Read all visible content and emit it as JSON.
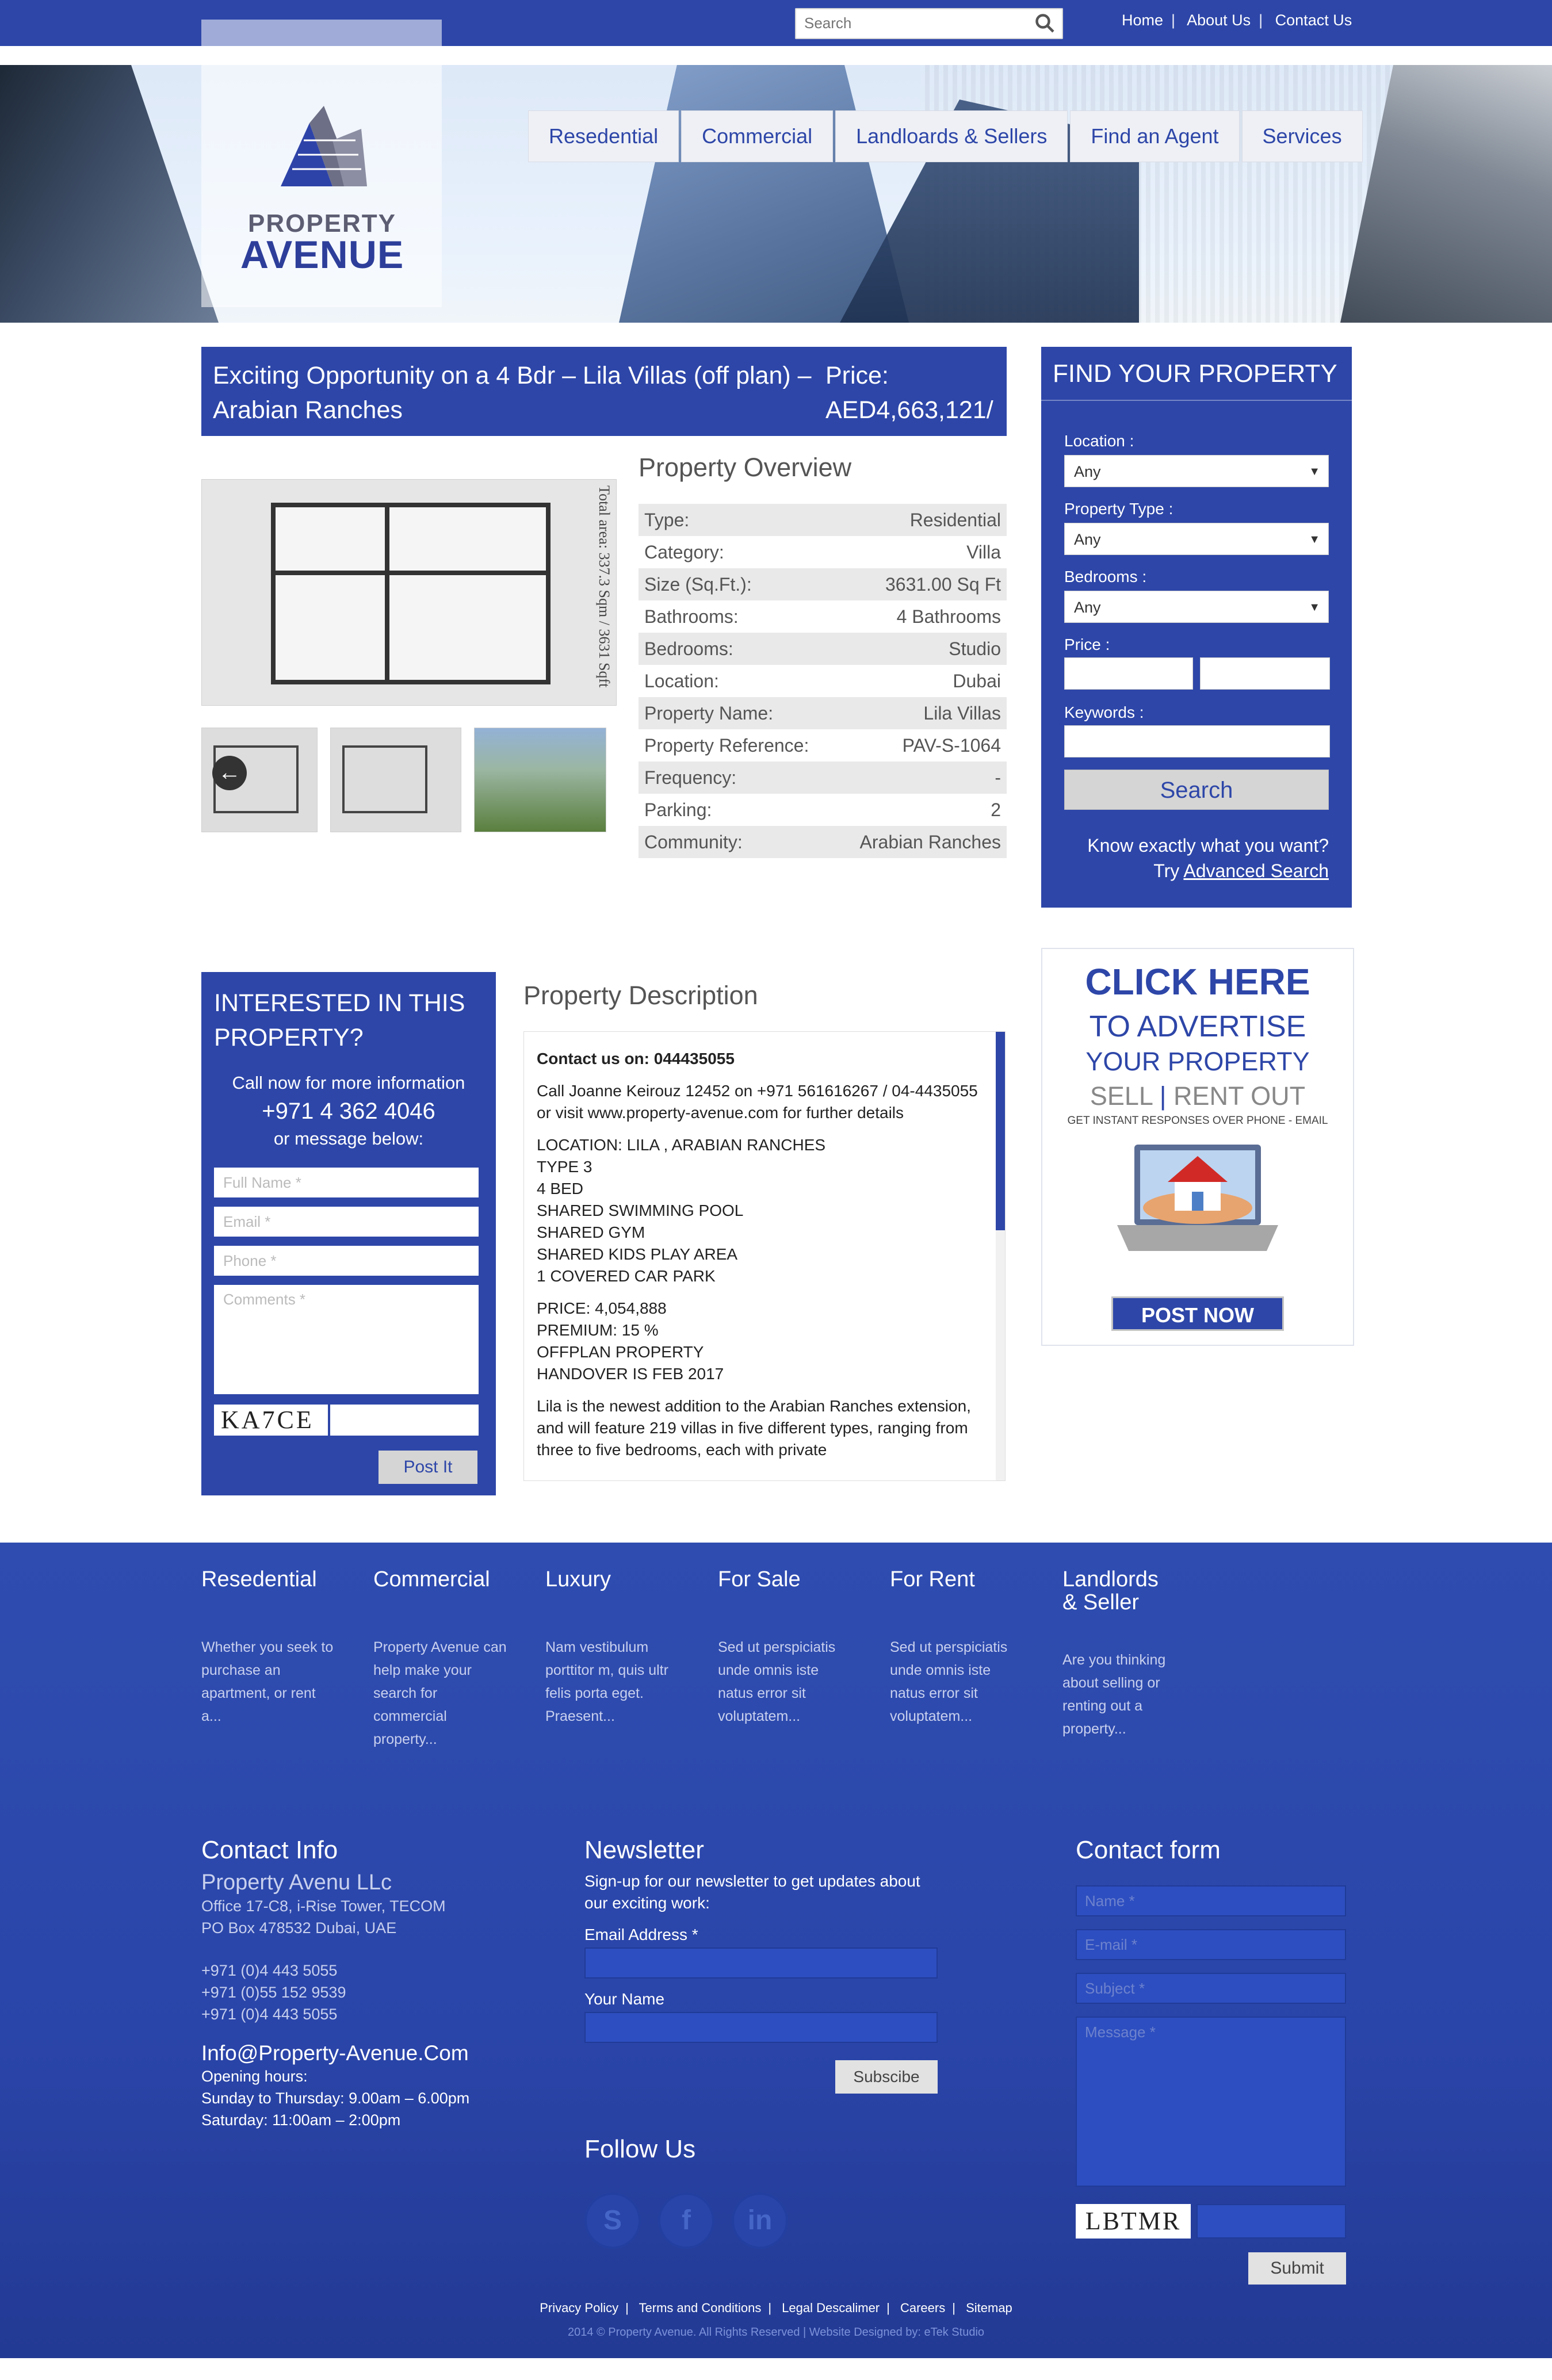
{
  "header": {
    "search_placeholder": "Search",
    "top_links": [
      "Home",
      "About Us",
      "Contact Us"
    ],
    "logo_line1": "PROPERTY",
    "logo_line2": "AVENUE",
    "nav": [
      "Resedential",
      "Commercial",
      "Landloards & Sellers",
      "Find an Agent",
      "Services"
    ]
  },
  "listing": {
    "title": "Exciting Opportunity on a 4 Bdr – Lila Villas (off plan) – Arabian Ranches",
    "price_label": "Price:",
    "price_value": "AED4,663,121/",
    "floorplan_text": "Total area: 337.3 Sqm / 3631 Sqft",
    "overview_title": "Property Overview",
    "overview": [
      {
        "label": "Type:",
        "value": "Residential"
      },
      {
        "label": "Category:",
        "value": "Villa"
      },
      {
        "label": "Size (Sq.Ft.):",
        "value": "3631.00 Sq Ft"
      },
      {
        "label": "Bathrooms:",
        "value": "4 Bathrooms"
      },
      {
        "label": "Bedrooms:",
        "value": "Studio"
      },
      {
        "label": "Location:",
        "value": "Dubai"
      },
      {
        "label": "Property Name:",
        "value": "Lila Villas"
      },
      {
        "label": "Property Reference:",
        "value": "PAV-S-1064"
      },
      {
        "label": "Frequency:",
        "value": "-"
      },
      {
        "label": "Parking:",
        "value": "2"
      },
      {
        "label": "Community:",
        "value": "Arabian Ranches"
      }
    ]
  },
  "find": {
    "title": "FIND YOUR PROPERTY",
    "location_label": "Location :",
    "location_value": "Any",
    "type_label": "Property Type :",
    "type_value": "Any",
    "bedrooms_label": "Bedrooms :",
    "bedrooms_value": "Any",
    "price_label": "Price :",
    "keywords_label": "Keywords :",
    "search_button": "Search",
    "know": "Know exactly what you want?",
    "try": "Try",
    "advanced": "Advanced Search"
  },
  "interest": {
    "title": "INTERESTED IN THIS PROPERTY?",
    "call": "Call now for more information",
    "phone": "+971 4 362 4046",
    "message": "or message below:",
    "fullname_ph": "Full Name *",
    "email_ph": "Email *",
    "phone_ph": "Phone *",
    "comments_ph": "Comments *",
    "captcha": "KA7CE",
    "post_button": "Post It"
  },
  "description": {
    "title": "Property Description",
    "contact": "Contact us on: 044435055",
    "call": "Call Joanne Keirouz 12452 on +971 561616267 / 04-4435055 or visit www.property-avenue.com for further details",
    "lines1": [
      "LOCATION: LILA , ARABIAN RANCHES",
      "TYPE 3",
      "4 BED",
      "SHARED SWIMMING POOL",
      "SHARED GYM",
      "SHARED KIDS PLAY AREA",
      "1 COVERED CAR PARK"
    ],
    "lines2": [
      "PRICE: 4,054,888",
      "PREMIUM: 15 %",
      "OFFPLAN PROPERTY",
      "HANDOVER IS FEB 2017"
    ],
    "para": "Lila is the newest addition to the Arabian Ranches extension, and will feature 219 villas in five different types, ranging from three to five bedrooms, each with private"
  },
  "ad": {
    "l1": "CLICK HERE",
    "l2": "TO ADVERTISE",
    "l3": "YOUR PROPERTY",
    "l4a": "SELL",
    "l4b": "|",
    "l4c": "RENT OUT",
    "l5": "GET INSTANT RESPONSES OVER PHONE - EMAIL",
    "button": "POST NOW"
  },
  "footer": {
    "cols": [
      {
        "title": "Resedential",
        "text": "Whether you seek to purchase an apartment, or rent a..."
      },
      {
        "title": "Commercial",
        "text": "Property Avenue can help make your search for commercial property..."
      },
      {
        "title": "Luxury",
        "text": "Nam vestibulum porttitor m, quis ultr felis porta eget. Praesent..."
      },
      {
        "title": "For Sale",
        "text": "Sed ut perspiciatis unde omnis iste natus error sit voluptatem..."
      },
      {
        "title": "For Rent",
        "text": "Sed ut perspiciatis unde omnis iste natus error sit voluptatem..."
      },
      {
        "title": "Landlords & Seller",
        "text": "Are you thinking about selling or renting out a property..."
      }
    ],
    "contact": {
      "title": "Contact Info",
      "company": "Property Avenu LLc",
      "addr1": "Office 17-C8, i-Rise Tower, TECOM",
      "addr2": "PO Box 478532 Dubai, UAE",
      "ph1": "+971 (0)4 443 5055",
      "ph2": "+971 (0)55 152 9539",
      "ph3": "+971 (0)4 443 5055",
      "email": "Info@Property-Avenue.Com",
      "hours_title": "Opening hours:",
      "hours1": "Sunday to Thursday: 9.00am – 6.00pm",
      "hours2": "Saturday: 11:00am – 2:00pm"
    },
    "newsletter": {
      "title": "Newsletter",
      "text": "Sign-up for our newsletter to get updates about our exciting work:",
      "email_label": "Email Address *",
      "name_label": "Your Name",
      "subscribe": "Subscibe",
      "follow": "Follow Us"
    },
    "contactform": {
      "title": "Contact form",
      "name_ph": "Name *",
      "email_ph": "E-mail *",
      "subject_ph": "Subject *",
      "message_ph": "Message *",
      "captcha": "LBTMR",
      "submit": "Submit"
    },
    "bottom_links": [
      "Privacy Policy",
      "Terms and Conditions",
      "Legal Descalimer",
      "Careers",
      "Sitemap"
    ],
    "copyright": "2014 © Property Avenue. All Rights Reserved | Website Designed by: eTek Studio"
  }
}
